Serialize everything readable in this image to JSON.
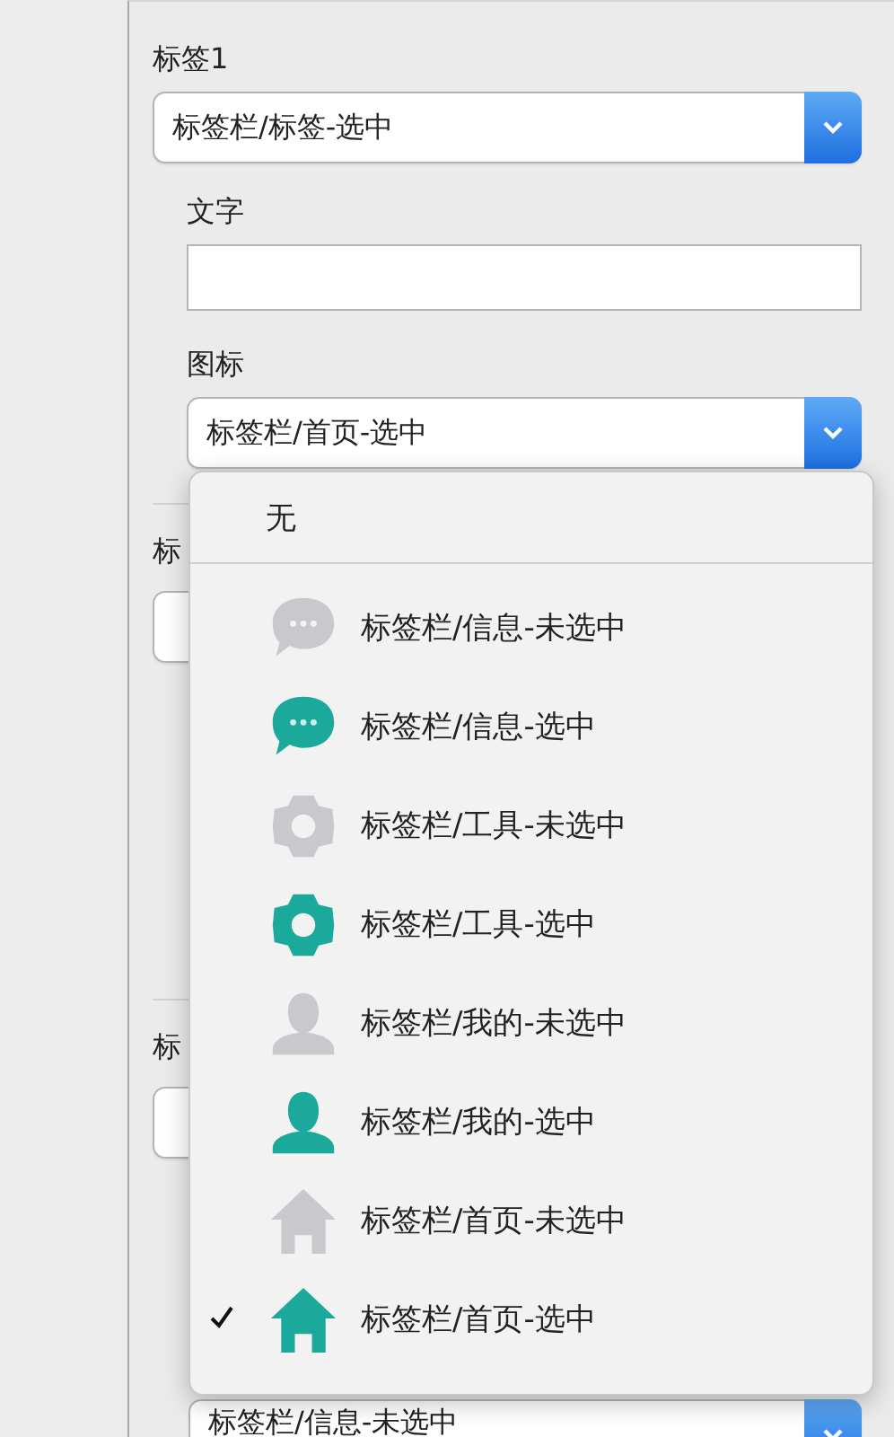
{
  "tab_1": {
    "heading": "标签1",
    "select": {
      "value": "标签栏/标签-选中"
    },
    "text_label": "文字",
    "icon_label": "图标",
    "icon_select": {
      "value": "标签栏/首页-选中"
    }
  },
  "tab_2": {
    "heading": "标"
  },
  "tab_3": {
    "heading": "标"
  },
  "bottom_select": {
    "value": "标签栏/信息-未选中"
  },
  "icon_menu": {
    "items": [
      {
        "kind": "none",
        "label": "无",
        "selected": false
      },
      {
        "kind": "message",
        "label": "标签栏/信息-未选中",
        "color": "#c9c9cd",
        "selected": false
      },
      {
        "kind": "message",
        "label": "标签栏/信息-选中",
        "color": "#1aa99b",
        "selected": false
      },
      {
        "kind": "gear",
        "label": "标签栏/工具-未选中",
        "color": "#c9c9cd",
        "selected": false
      },
      {
        "kind": "gear",
        "label": "标签栏/工具-选中",
        "color": "#1aa99b",
        "selected": false
      },
      {
        "kind": "person",
        "label": "标签栏/我的-未选中",
        "color": "#c9c9cd",
        "selected": false
      },
      {
        "kind": "person",
        "label": "标签栏/我的-选中",
        "color": "#1aa99b",
        "selected": false
      },
      {
        "kind": "home",
        "label": "标签栏/首页-未选中",
        "color": "#c9c9cd",
        "selected": false
      },
      {
        "kind": "home",
        "label": "标签栏/首页-选中",
        "color": "#1aa99b",
        "selected": true
      }
    ]
  }
}
